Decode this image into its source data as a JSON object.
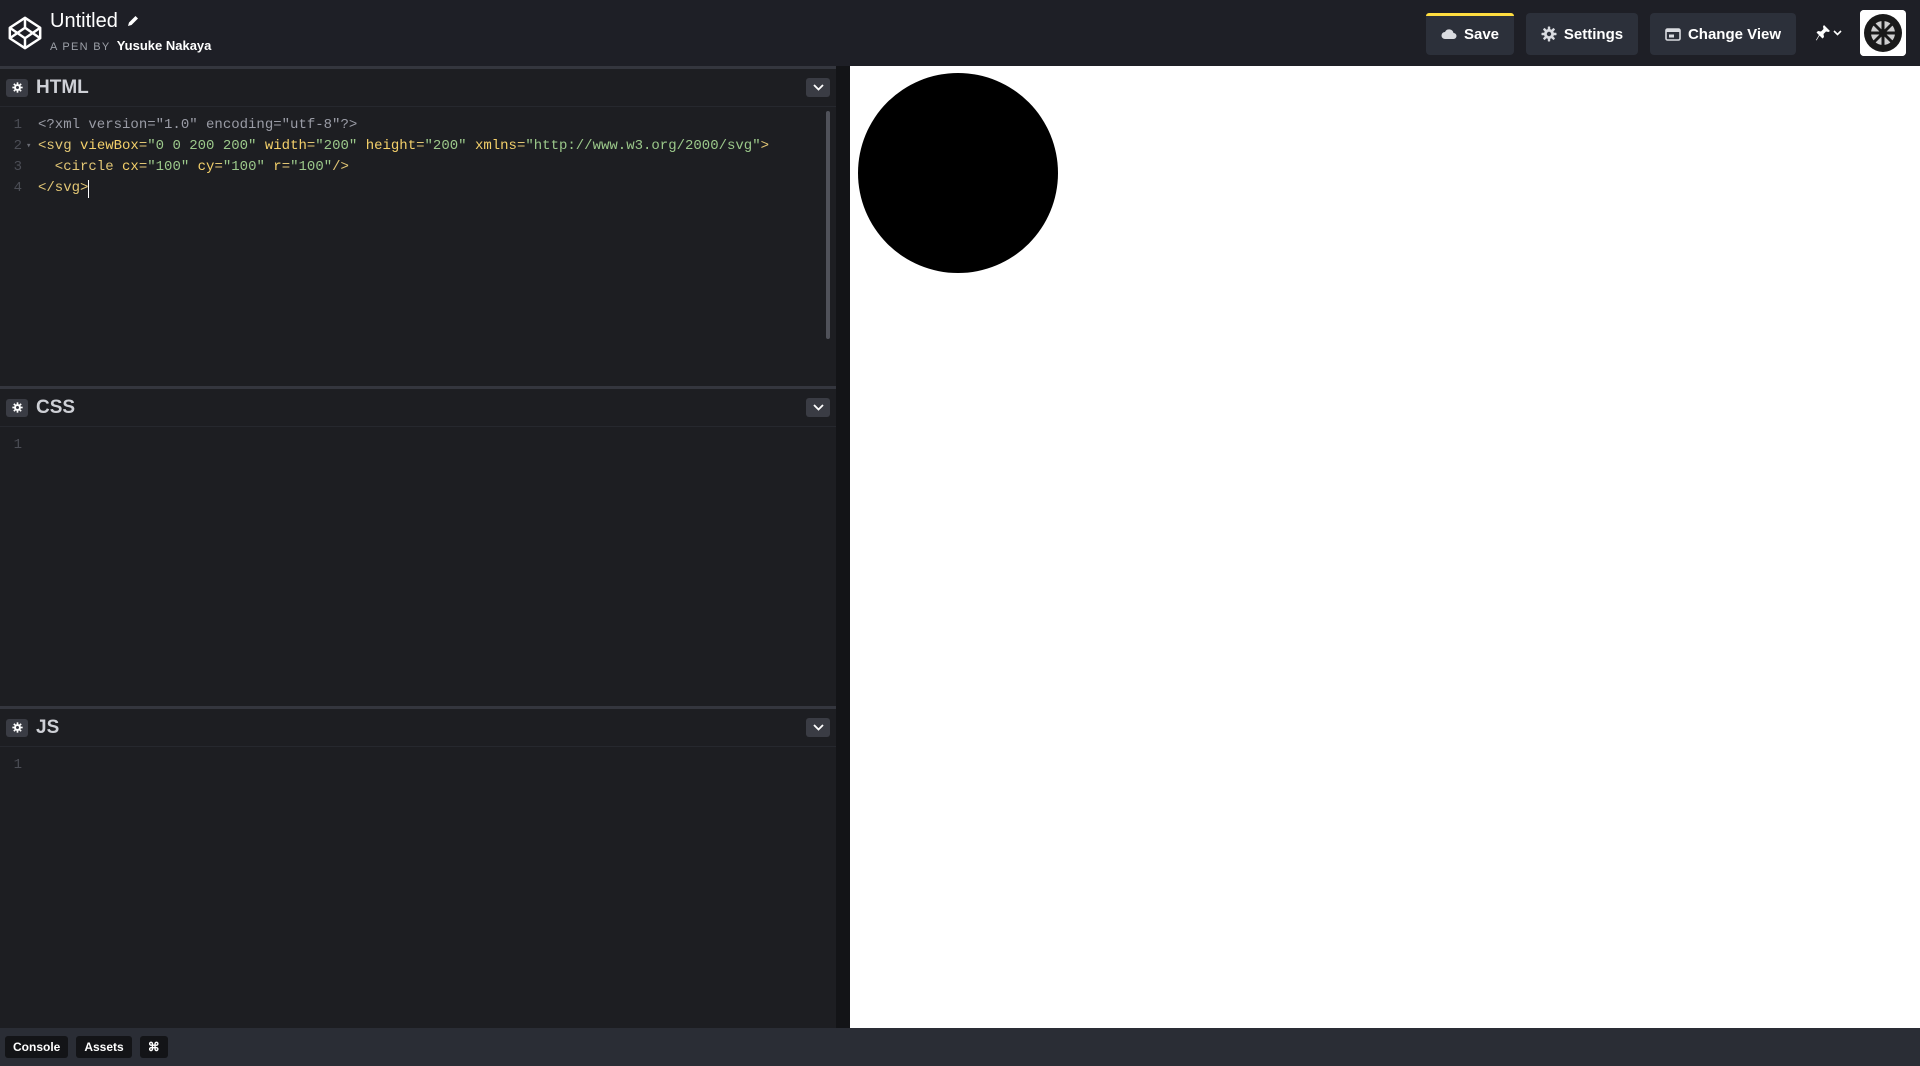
{
  "header": {
    "pen_title": "Untitled",
    "byline_prefix": "A PEN BY",
    "author": "Yusuke Nakaya",
    "buttons": {
      "save": "Save",
      "settings": "Settings",
      "change_view": "Change View"
    },
    "icons": [
      "codepen-logo-icon",
      "pencil-icon",
      "cloud-icon",
      "gear-icon",
      "change-view-icon",
      "pin-icon",
      "chevron-down-icon",
      "avatar"
    ]
  },
  "editors": {
    "html": {
      "name": "HTML",
      "lines": [
        {
          "n": "1",
          "parts": [
            [
              "decl",
              "<?xml version=\"1.0\" encoding=\"utf-8\"?>"
            ]
          ]
        },
        {
          "n": "2",
          "fold": true,
          "parts": [
            [
              "tag",
              "<svg "
            ],
            [
              "attr",
              "viewBox"
            ],
            [
              "eq",
              "="
            ],
            [
              "str",
              "\"0 0 200 200\""
            ],
            [
              "tag",
              " "
            ],
            [
              "attr",
              "width"
            ],
            [
              "eq",
              "="
            ],
            [
              "str",
              "\"200\""
            ],
            [
              "tag",
              " "
            ],
            [
              "attr",
              "height"
            ],
            [
              "eq",
              "="
            ],
            [
              "str",
              "\"200\""
            ],
            [
              "tag",
              " "
            ],
            [
              "attr",
              "xmlns"
            ],
            [
              "eq",
              "="
            ],
            [
              "str",
              "\"http://www.w3.org/2000/svg\""
            ],
            [
              "tag",
              ">"
            ]
          ]
        },
        {
          "n": "3",
          "parts": [
            [
              "tag",
              "  <circle "
            ],
            [
              "attr",
              "cx"
            ],
            [
              "eq",
              "="
            ],
            [
              "str",
              "\"100\""
            ],
            [
              "tag",
              " "
            ],
            [
              "attr",
              "cy"
            ],
            [
              "eq",
              "="
            ],
            [
              "str",
              "\"100\""
            ],
            [
              "tag",
              " "
            ],
            [
              "attr",
              "r"
            ],
            [
              "eq",
              "="
            ],
            [
              "str",
              "\"100\""
            ],
            [
              "tag",
              "/>"
            ]
          ]
        },
        {
          "n": "4",
          "cursor": true,
          "parts": [
            [
              "tag",
              "</svg>"
            ]
          ]
        }
      ]
    },
    "css": {
      "name": "CSS",
      "lines": [
        {
          "n": "1",
          "parts": []
        }
      ]
    },
    "js": {
      "name": "JS",
      "lines": [
        {
          "n": "1",
          "parts": []
        }
      ]
    }
  },
  "footer": {
    "console": "Console",
    "assets": "Assets",
    "shortcuts": "⌘"
  },
  "colors": {
    "background": "#131417",
    "panel": "#1d1e22",
    "header": "#1e1f26",
    "button": "#2c303a",
    "save_accent": "#ffdd40",
    "preview_bg": "#ffffff",
    "preview_shape": "#000000"
  }
}
